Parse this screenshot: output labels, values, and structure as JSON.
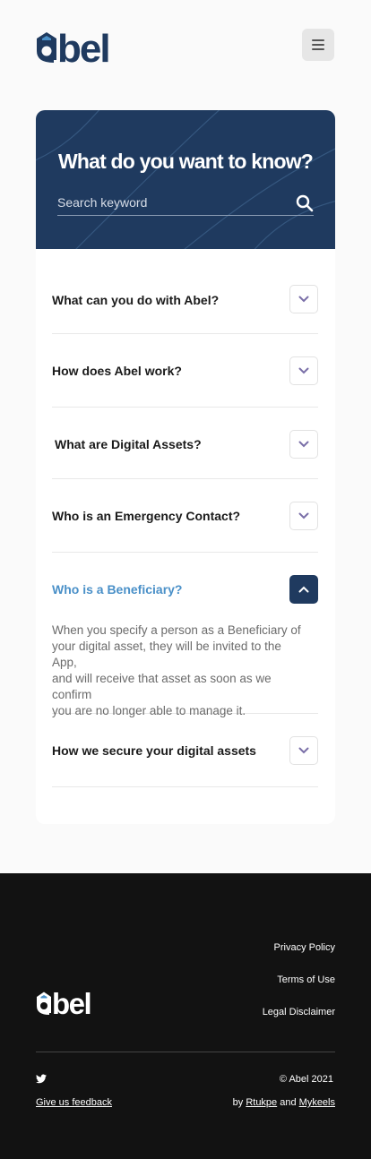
{
  "header": {
    "logo_text": "abel",
    "menu_icon": "hamburger-icon"
  },
  "hero": {
    "title": "What do you want to know?",
    "search_placeholder": "Search keyword",
    "search_icon": "search-icon"
  },
  "faq": [
    {
      "question": "What can you do with Abel?",
      "expanded": false
    },
    {
      "question": "How does Abel work?",
      "expanded": false
    },
    {
      "question": "What are Digital Assets?",
      "expanded": false
    },
    {
      "question": "Who is an Emergency Contact?",
      "expanded": false
    },
    {
      "question": "Who is a Beneficiary?",
      "expanded": true,
      "answer_lines": [
        "When you specify a person as a Beneficiary of",
        "your digital asset, they will be invited to the App,",
        "and will receive that asset as soon as we confirm",
        "you are no longer able to manage it."
      ]
    },
    {
      "question": "How we secure your digital assets",
      "expanded": false
    }
  ],
  "footer": {
    "logo_text": "abel",
    "links": [
      "Privacy Policy",
      "Terms of Use",
      "Legal Disclaimer"
    ],
    "twitter_icon": "twitter-icon",
    "feedback_label": "Give us feedback",
    "copyright": "© Abel 2021",
    "credits_prefix": "by",
    "credits_author1": "Rtukpe",
    "credits_and": "and",
    "credits_author2": "Mykeels"
  },
  "colors": {
    "navy": "#1f3a5f",
    "accent_blue": "#4a90c8",
    "footer_bg": "#121212"
  }
}
